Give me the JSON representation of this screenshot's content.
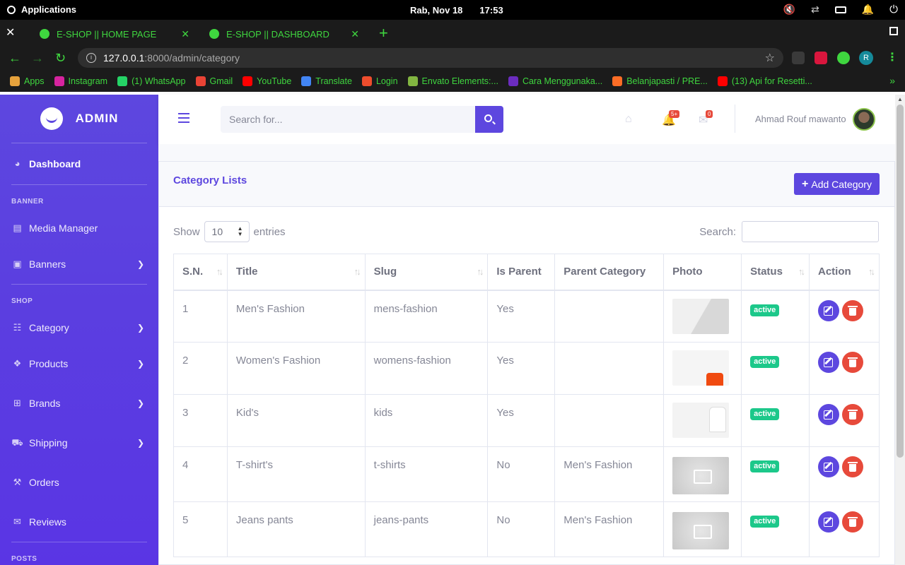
{
  "os": {
    "applications": "Applications",
    "date": "Rab, Nov 18",
    "time": "17:53"
  },
  "browser": {
    "tabs": [
      {
        "label": "E-SHOP || HOME PAGE"
      },
      {
        "label": "E-SHOP || DASHBOARD"
      }
    ],
    "url_host": "127.0.0.1",
    "url_path": ":8000/admin/category",
    "profile_initial": "R",
    "bookmarks": [
      {
        "label": "Apps",
        "color": "#e6a23c"
      },
      {
        "label": "Instagram",
        "color": "#d6249f"
      },
      {
        "label": "(1) WhatsApp",
        "color": "#25d366"
      },
      {
        "label": "Gmail",
        "color": "#ea4335"
      },
      {
        "label": "YouTube",
        "color": "#ff0000"
      },
      {
        "label": "Translate",
        "color": "#4285f4"
      },
      {
        "label": "Login",
        "color": "#ee4d2d"
      },
      {
        "label": "Envato Elements:...",
        "color": "#82b541"
      },
      {
        "label": "Cara Menggunaka...",
        "color": "#6b2cbf"
      },
      {
        "label": "Belanjapasti / PRE...",
        "color": "#fc6d26"
      },
      {
        "label": "(13) Api for Resetti...",
        "color": "#ff0000"
      }
    ]
  },
  "sidebar": {
    "brand": "ADMIN",
    "dashboard": "Dashboard",
    "heading_banner": "BANNER",
    "media_manager": "Media Manager",
    "banners": "Banners",
    "heading_shop": "SHOP",
    "category": "Category",
    "products": "Products",
    "brands": "Brands",
    "shipping": "Shipping",
    "orders": "Orders",
    "reviews": "Reviews",
    "heading_posts": "POSTS"
  },
  "topbar": {
    "search_placeholder": "Search for...",
    "alerts_badge": "5+",
    "messages_badge": "0",
    "user_name": "Ahmad Rouf mawanto"
  },
  "card": {
    "title": "Category Lists",
    "add_button": "Add Category",
    "show_label": "Show",
    "entries_value": "10",
    "entries_label": "entries",
    "search_label": "Search:"
  },
  "table": {
    "headers": [
      "S.N.",
      "Title",
      "Slug",
      "Is Parent",
      "Parent Category",
      "Photo",
      "Status",
      "Action"
    ],
    "rows": [
      {
        "sn": "1",
        "title": "Men's Fashion",
        "slug": "mens-fashion",
        "is_parent": "Yes",
        "parent": "",
        "status": "active"
      },
      {
        "sn": "2",
        "title": "Women's Fashion",
        "slug": "womens-fashion",
        "is_parent": "Yes",
        "parent": "",
        "status": "active"
      },
      {
        "sn": "3",
        "title": "Kid's",
        "slug": "kids",
        "is_parent": "Yes",
        "parent": "",
        "status": "active"
      },
      {
        "sn": "4",
        "title": "T-shirt's",
        "slug": "t-shirts",
        "is_parent": "No",
        "parent": "Men's Fashion",
        "status": "active"
      },
      {
        "sn": "5",
        "title": "Jeans pants",
        "slug": "jeans-pants",
        "is_parent": "No",
        "parent": "Men's Fashion",
        "status": "active"
      }
    ]
  },
  "colors": {
    "primary": "#5d47df",
    "success": "#1cc88a",
    "danger": "#e74a3b",
    "browser_accent": "#3fd63f"
  }
}
